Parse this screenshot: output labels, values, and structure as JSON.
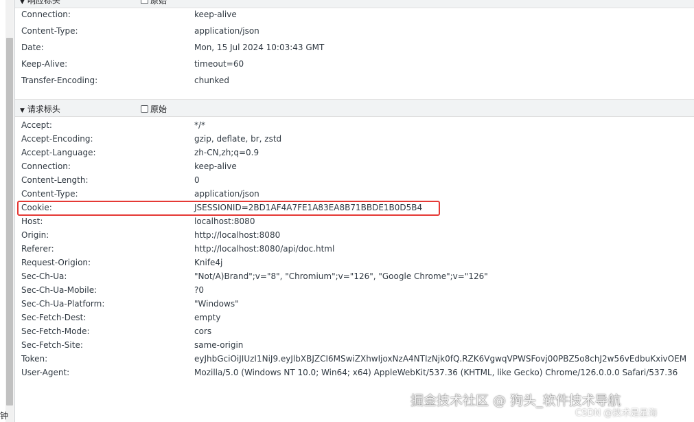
{
  "left_edge_text": "钟",
  "response_headers": {
    "title": "响应标头",
    "raw_label": "原始",
    "rows": [
      {
        "key": "Connection:",
        "value": "keep-alive"
      },
      {
        "key": "Content-Type:",
        "value": "application/json"
      },
      {
        "key": "Date:",
        "value": "Mon, 15 Jul 2024 10:03:43 GMT"
      },
      {
        "key": "Keep-Alive:",
        "value": "timeout=60"
      },
      {
        "key": "Transfer-Encoding:",
        "value": "chunked"
      }
    ]
  },
  "request_headers": {
    "title": "请求标头",
    "raw_label": "原始",
    "rows": [
      {
        "key": "Accept:",
        "value": "*/*"
      },
      {
        "key": "Accept-Encoding:",
        "value": "gzip, deflate, br, zstd"
      },
      {
        "key": "Accept-Language:",
        "value": "zh-CN,zh;q=0.9"
      },
      {
        "key": "Connection:",
        "value": "keep-alive"
      },
      {
        "key": "Content-Length:",
        "value": "0"
      },
      {
        "key": "Content-Type:",
        "value": "application/json"
      },
      {
        "key": "Cookie:",
        "value": "JSESSIONID=2BD1AF4A7FE1A83EA8B71BBDE1B0D5B4"
      },
      {
        "key": "Host:",
        "value": "localhost:8080"
      },
      {
        "key": "Origin:",
        "value": "http://localhost:8080"
      },
      {
        "key": "Referer:",
        "value": "http://localhost:8080/api/doc.html"
      },
      {
        "key": "Request-Origion:",
        "value": "Knife4j"
      },
      {
        "key": "Sec-Ch-Ua:",
        "value": "\"Not/A)Brand\";v=\"8\", \"Chromium\";v=\"126\", \"Google Chrome\";v=\"126\""
      },
      {
        "key": "Sec-Ch-Ua-Mobile:",
        "value": "?0"
      },
      {
        "key": "Sec-Ch-Ua-Platform:",
        "value": "\"Windows\""
      },
      {
        "key": "Sec-Fetch-Dest:",
        "value": "empty"
      },
      {
        "key": "Sec-Fetch-Mode:",
        "value": "cors"
      },
      {
        "key": "Sec-Fetch-Site:",
        "value": "same-origin"
      },
      {
        "key": "Token:",
        "value": "eyJhbGciOiJIUzI1NiJ9.eyJlbXBJZCI6MSwiZXhwIjoxNzA4NTIzNjk0fQ.RZK6VgwqVPWSFovj00PBZ5o8chJ2w56vEdbuKxivOEM"
      },
      {
        "key": "User-Agent:",
        "value": "Mozilla/5.0 (Windows NT 10.0; Win64; x64) AppleWebKit/537.36 (KHTML, like Gecko) Chrome/126.0.0.0 Safari/537.36"
      }
    ]
  },
  "highlight": {
    "color": "#e53935",
    "target": "Cookie:"
  },
  "watermark": {
    "main": "掘金技术社区 @ 狗头_软件技术导航",
    "sub": "CSDN @技术是星海"
  }
}
